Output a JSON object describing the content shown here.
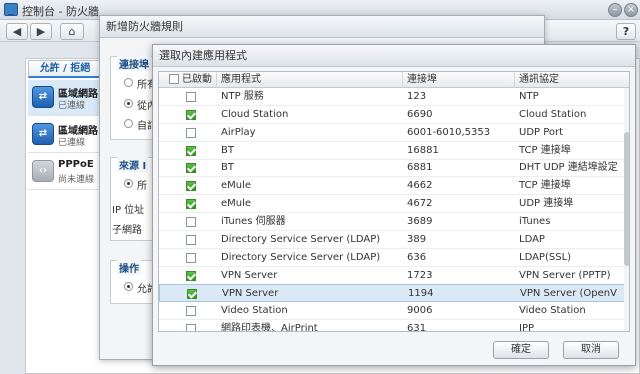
{
  "window": {
    "title": "控制台 - 防火牆"
  },
  "toolbar": {
    "back": "◀",
    "forward": "▶",
    "home": "⌂",
    "help": "?"
  },
  "left_panel": {
    "tab_label": "允許 / 拒絕",
    "interfaces": [
      {
        "name": "區域網路",
        "status": "已連線",
        "icon": "network-icon"
      },
      {
        "name": "區域網路",
        "status": "已連線",
        "icon": "network-icon"
      },
      {
        "name": "PPPoE",
        "status": "尚未連線",
        "icon": "pppoe-icon"
      }
    ]
  },
  "dialog2": {
    "title": "新增防火牆規則",
    "group1_title": "連接埠",
    "radio_labels": [
      "所有",
      "從內",
      "自訂"
    ],
    "group2_title": "來源 I",
    "radio_all": "所",
    "ip_label": "IP 位址",
    "subnet_label": "子網路",
    "group3_title": "操作",
    "radio_allow": "允許"
  },
  "dialog3": {
    "title": "選取內建應用程式",
    "columns": [
      "已啟動",
      "應用程式",
      "連接埠",
      "通訊協定"
    ],
    "rows": [
      {
        "enabled": false,
        "app": "NTP 服務",
        "port": "123",
        "protocol": "NTP"
      },
      {
        "enabled": true,
        "app": "Cloud Station",
        "port": "6690",
        "protocol": "Cloud Station"
      },
      {
        "enabled": false,
        "app": "AirPlay",
        "port": "6001-6010,5353",
        "protocol": "UDP Port"
      },
      {
        "enabled": true,
        "app": "BT",
        "port": "16881",
        "protocol": "TCP 連接埠"
      },
      {
        "enabled": true,
        "app": "BT",
        "port": "6881",
        "protocol": "DHT UDP 連結埠設定"
      },
      {
        "enabled": true,
        "app": "eMule",
        "port": "4662",
        "protocol": "TCP 連接埠"
      },
      {
        "enabled": true,
        "app": "eMule",
        "port": "4672",
        "protocol": "UDP 連接埠"
      },
      {
        "enabled": false,
        "app": "iTunes 伺服器",
        "port": "3689",
        "protocol": "iTunes"
      },
      {
        "enabled": false,
        "app": "Directory Service Server (LDAP)",
        "port": "389",
        "protocol": "LDAP"
      },
      {
        "enabled": false,
        "app": "Directory Service Server (LDAP)",
        "port": "636",
        "protocol": "LDAP(SSL)"
      },
      {
        "enabled": true,
        "app": "VPN Server",
        "port": "1723",
        "protocol": "VPN Server (PPTP)"
      },
      {
        "enabled": true,
        "app": "VPN Server",
        "port": "1194",
        "protocol": "VPN Server (OpenV"
      },
      {
        "enabled": false,
        "app": "Video Station",
        "port": "9006",
        "protocol": "Video Station"
      },
      {
        "enabled": false,
        "app": "網路印表機、AirPrint",
        "port": "631",
        "protocol": "IPP"
      }
    ],
    "ok_label": "確定",
    "cancel_label": "取消"
  }
}
